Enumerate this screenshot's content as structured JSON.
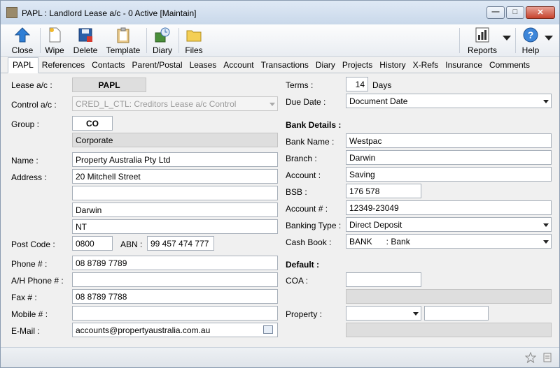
{
  "window": {
    "title": "PAPL : Landlord Lease a/c - 0 Active [Maintain]"
  },
  "toolbar": {
    "close": "Close",
    "wipe": "Wipe",
    "delete": "Delete",
    "template": "Template",
    "diary": "Diary",
    "files": "Files",
    "reports": "Reports",
    "help": "Help"
  },
  "tabs": [
    "PAPL",
    "References",
    "Contacts",
    "Parent/Postal",
    "Leases",
    "Account",
    "Transactions",
    "Diary",
    "Projects",
    "History",
    "X-Refs",
    "Insurance",
    "Comments"
  ],
  "form": {
    "lease_ac_label": "Lease a/c :",
    "lease_ac": "PAPL",
    "control_ac_label": "Control a/c :",
    "control_ac": "CRED_L_CTL: Creditors Lease a/c Control",
    "group_label": "Group :",
    "group_code": "CO",
    "group_name": "Corporate",
    "name_label": "Name :",
    "name": "Property Australia Pty Ltd",
    "address_label": "Address :",
    "address1": "20 Mitchell Street",
    "address2": "",
    "address3": "Darwin",
    "address4": "NT",
    "postcode_label": "Post Code :",
    "postcode": "0800",
    "abn_label": "ABN :",
    "abn": "99 457 474 777",
    "phone_label": "Phone # :",
    "phone": "08 8789 7789",
    "ah_phone_label": "A/H Phone # :",
    "ah_phone": "",
    "fax_label": "Fax # :",
    "fax": "08 8789 7788",
    "mobile_label": "Mobile # :",
    "mobile": "",
    "email_label": "E-Mail :",
    "email": "accounts@propertyaustralia.com.au",
    "terms_label": "Terms :",
    "terms": "14",
    "terms_unit": "Days",
    "due_date_label": "Due Date :",
    "due_date": "Document Date",
    "bank_details_header": "Bank Details :",
    "bank_name_label": "Bank Name :",
    "bank_name": "Westpac",
    "branch_label": "Branch :",
    "branch": "Darwin",
    "account_label": "Account :",
    "account": "Saving",
    "bsb_label": "BSB :",
    "bsb": "176 578",
    "account_no_label": "Account # :",
    "account_no": "12349-23049",
    "banking_type_label": "Banking Type :",
    "banking_type": "Direct Deposit",
    "cash_book_label": "Cash Book :",
    "cash_book": "BANK      : Bank",
    "default_header": "Default :",
    "coa_label": "COA :",
    "coa": "",
    "property_label": "Property :",
    "property": ""
  }
}
